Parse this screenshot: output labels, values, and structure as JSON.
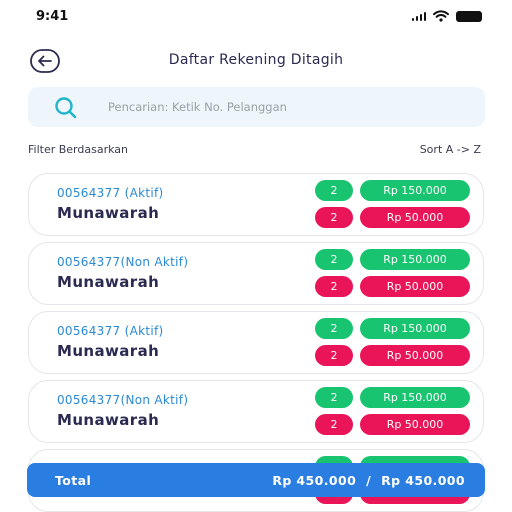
{
  "status_bar": {
    "time": "9:41"
  },
  "header": {
    "title": "Daftar Rekening Ditagih"
  },
  "search": {
    "placeholder": "Pencarian: Ketik No. Pelanggan",
    "value": ""
  },
  "filter": {
    "label": "Filter Berdasarkan",
    "sort_label": "Sort A -> Z"
  },
  "accounts": [
    {
      "number": "00564377",
      "status": "(Aktif)",
      "name": "Munawarah",
      "paid_count": "2",
      "paid_amount": "Rp 150.000",
      "due_count": "2",
      "due_amount": "Rp 50.000"
    },
    {
      "number": "00564377",
      "status": "(Non Aktif)",
      "name": "Munawarah",
      "paid_count": "2",
      "paid_amount": "Rp 150.000",
      "due_count": "2",
      "due_amount": "Rp 50.000"
    },
    {
      "number": "00564377",
      "status": "(Aktif)",
      "name": "Munawarah",
      "paid_count": "2",
      "paid_amount": "Rp 150.000",
      "due_count": "2",
      "due_amount": "Rp 50.000"
    },
    {
      "number": "00564377",
      "status": "(Non Aktif)",
      "name": "Munawarah",
      "paid_count": "2",
      "paid_amount": "Rp 150.000",
      "due_count": "2",
      "due_amount": "Rp 50.000"
    }
  ],
  "total": {
    "label": "Total",
    "amount_left": "Rp 450.000",
    "separator": "/",
    "amount_right": "Rp 450.000"
  },
  "colors": {
    "primary": "#2a7de1",
    "link": "#2a8ad6",
    "success": "#18c46f",
    "danger": "#ea1458",
    "text": "#2b2b52"
  },
  "icons": {
    "back": "back-arrow-circle-icon",
    "search": "search-icon",
    "signal": "signal-icon",
    "wifi": "wifi-icon",
    "battery": "battery-icon"
  }
}
